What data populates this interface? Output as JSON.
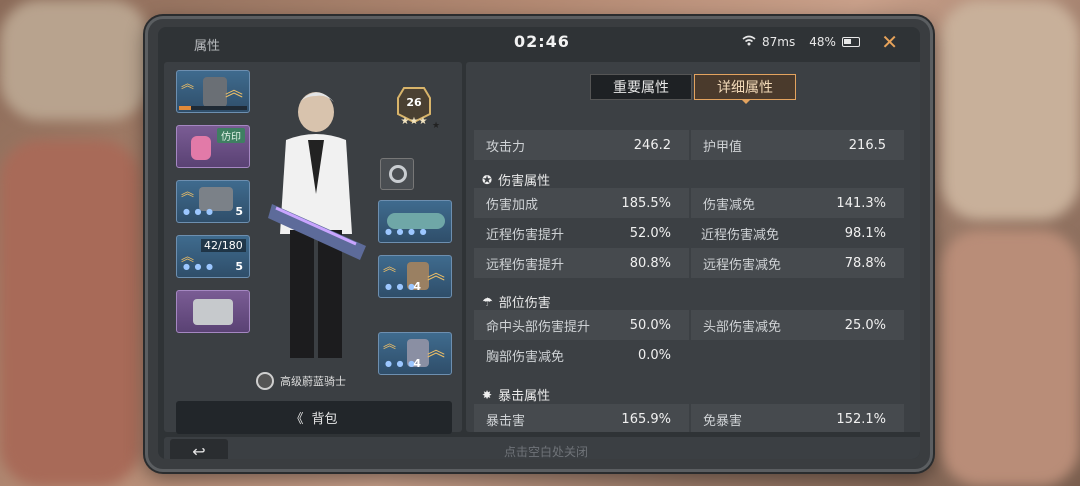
{
  "header": {
    "title": "属性",
    "time": "02:46",
    "ping": "87ms",
    "battery": "48%"
  },
  "tabs": [
    {
      "label": "重要属性",
      "active": false
    },
    {
      "label": "详细属性",
      "active": true
    }
  ],
  "character": {
    "level": "26",
    "rank_name": "高级蔚蓝骑士",
    "bag_label": "背包"
  },
  "slots": {
    "seal_tag": "仿印",
    "ammo_counter": "42/180",
    "weapon_level_a": "5",
    "weapon_level_b": "5",
    "armor_level_a": "4",
    "armor_level_b": "4"
  },
  "top_stats": [
    {
      "label": "攻击力",
      "value": "246.2"
    },
    {
      "label": "护甲值",
      "value": "216.5"
    }
  ],
  "sections": [
    {
      "title": "伤害属性",
      "rows": [
        [
          {
            "label": "伤害加成",
            "value": "185.5%"
          },
          {
            "label": "伤害减免",
            "value": "141.3%"
          }
        ],
        [
          {
            "label": "近程伤害提升",
            "value": "52.0%"
          },
          {
            "label": "近程伤害减免",
            "value": "98.1%"
          }
        ],
        [
          {
            "label": "远程伤害提升",
            "value": "80.8%"
          },
          {
            "label": "远程伤害减免",
            "value": "78.8%"
          }
        ]
      ]
    },
    {
      "title": "部位伤害",
      "rows": [
        [
          {
            "label": "命中头部伤害提升",
            "value": "50.0%"
          },
          {
            "label": "头部伤害减免",
            "value": "25.0%"
          }
        ],
        [
          {
            "label": "胸部伤害减免",
            "value": "0.0%"
          },
          {
            "label": "",
            "value": ""
          }
        ]
      ]
    },
    {
      "title": "暴击属性",
      "rows": [
        [
          {
            "label": "暴击害",
            "value": "165.9%"
          },
          {
            "label": "免暴害",
            "value": "152.1%"
          }
        ]
      ]
    }
  ],
  "footer": {
    "hint": "点击空白处关闭"
  },
  "colors": {
    "accent": "#e3a35f",
    "panel": "#3c4044",
    "blue_slot": "#3f6b8e",
    "purple_slot": "#7a5c94"
  }
}
